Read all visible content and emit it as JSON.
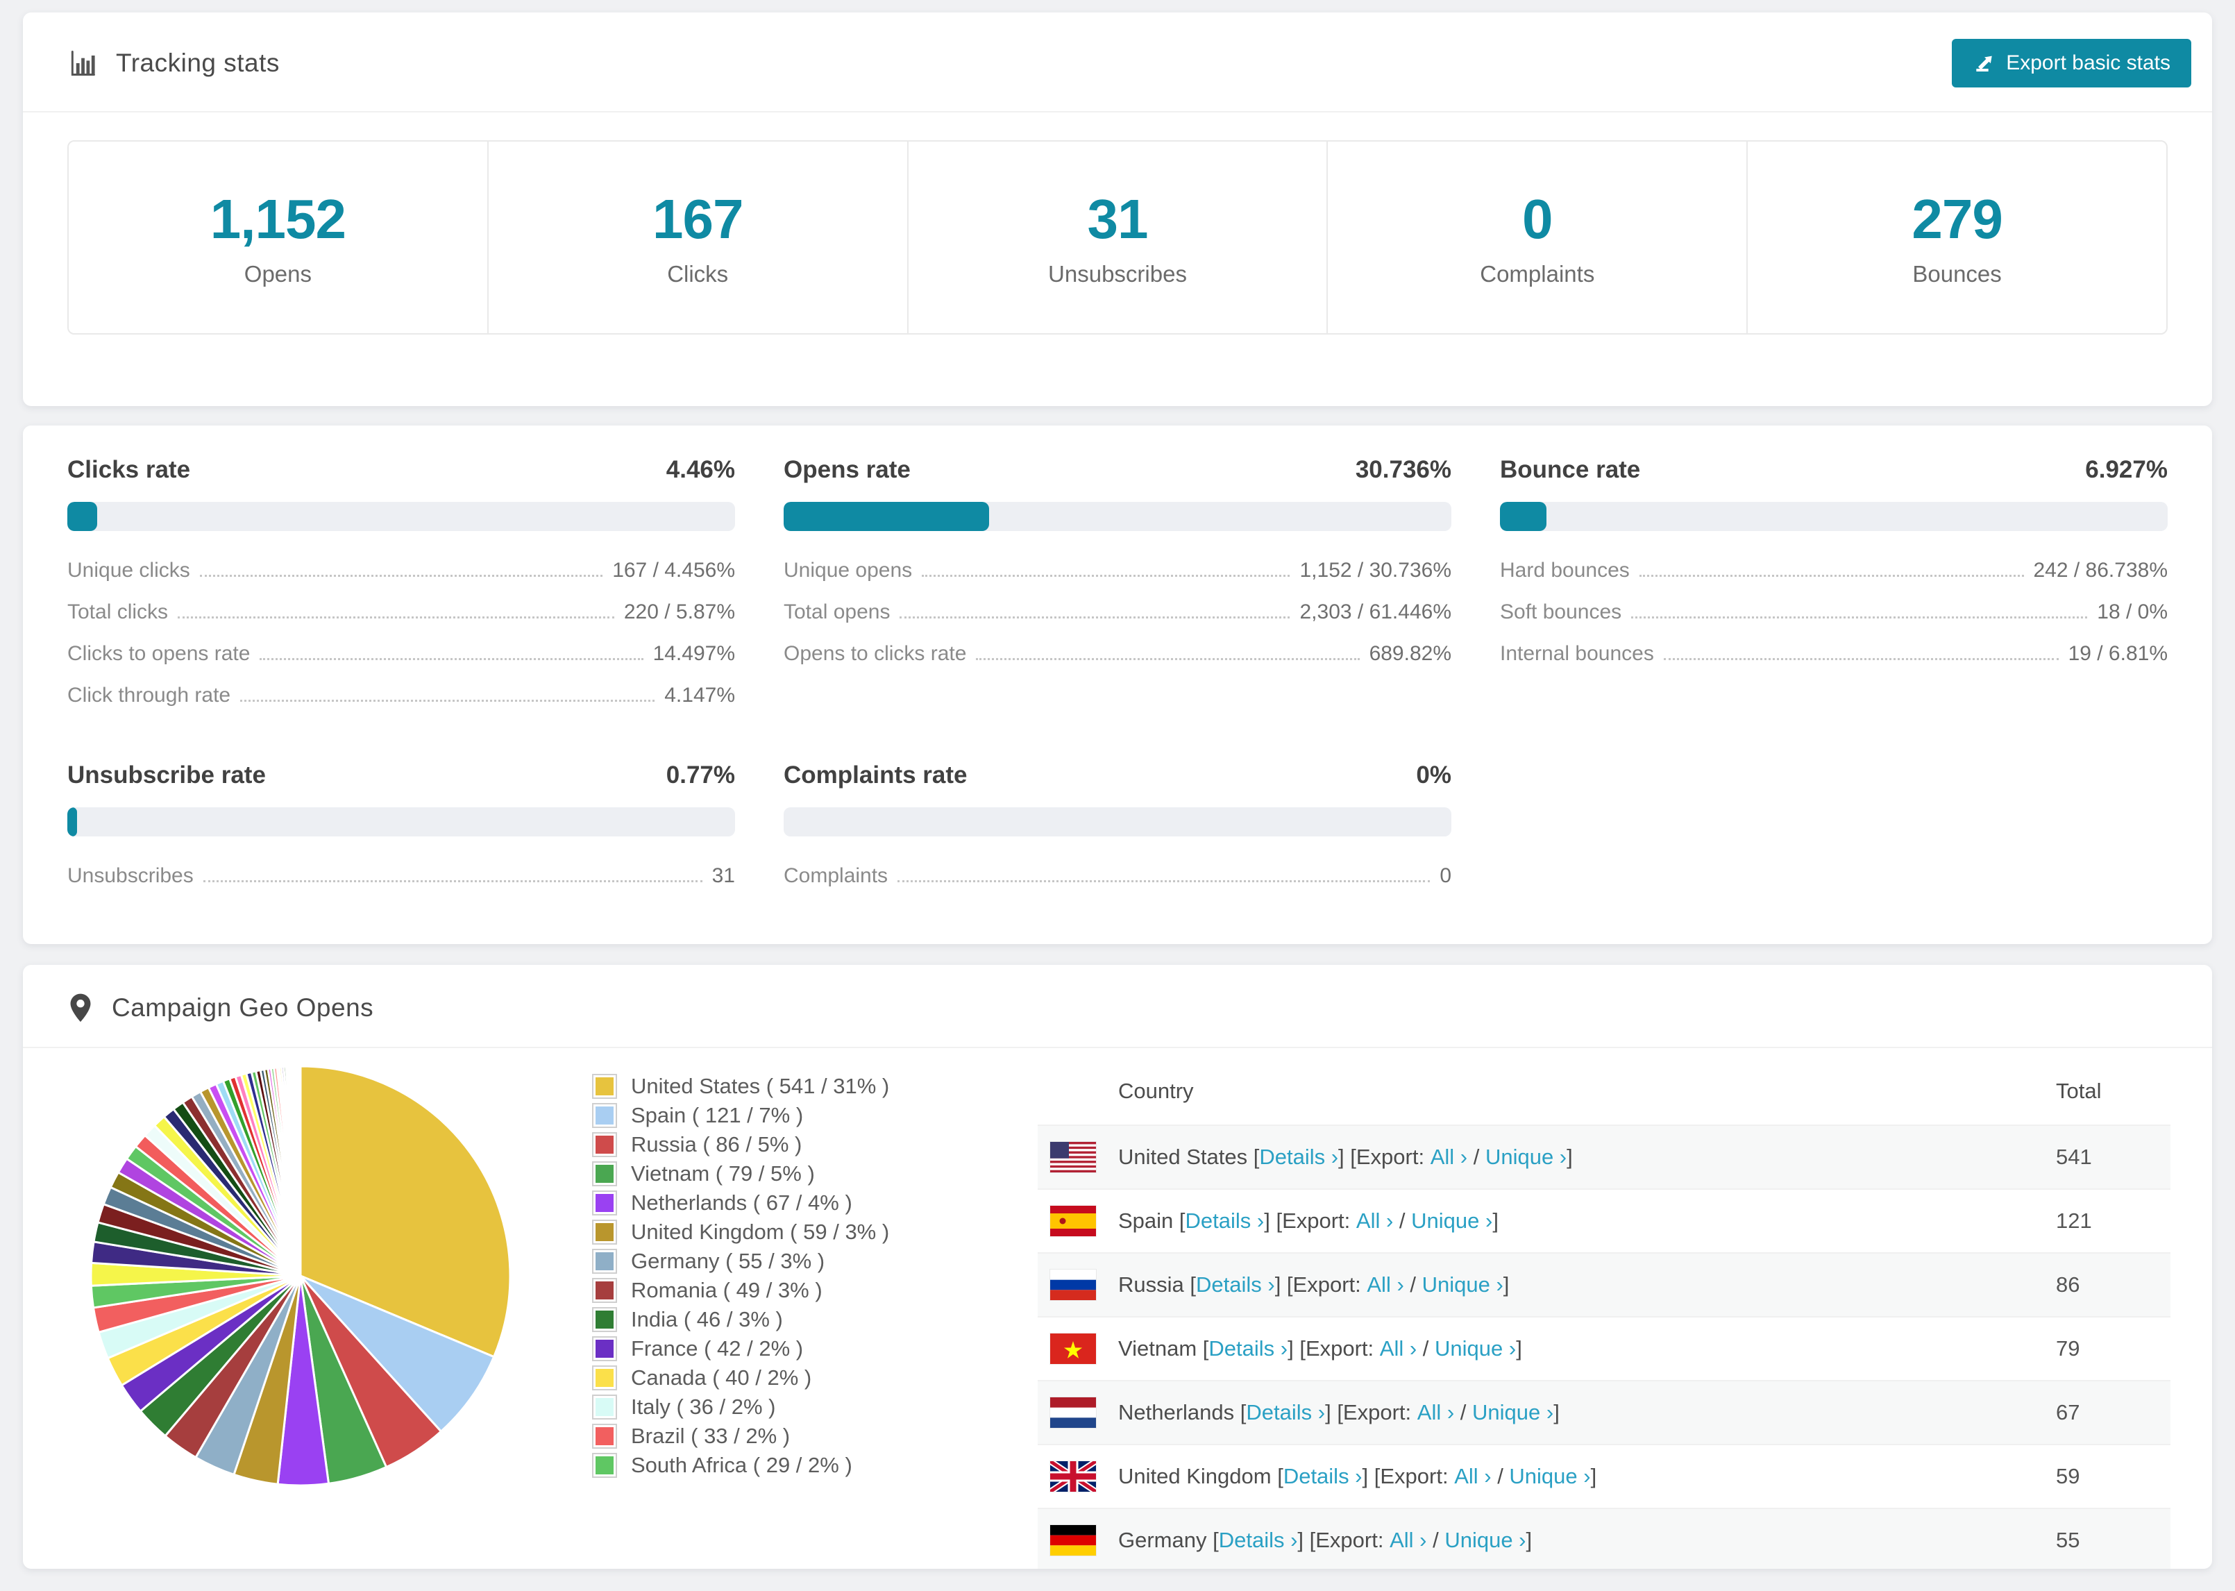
{
  "colors": {
    "accent": "#0f8aa3",
    "link": "#2aa0c4",
    "page_background": "#f0f1f3",
    "bar_track": "#edeff3"
  },
  "header": {
    "title": "Tracking stats",
    "export_label": "Export basic stats",
    "icon": "bar-chart-icon"
  },
  "stats": [
    {
      "value": "1,152",
      "label": "Opens"
    },
    {
      "value": "167",
      "label": "Clicks"
    },
    {
      "value": "31",
      "label": "Unsubscribes"
    },
    {
      "value": "0",
      "label": "Complaints"
    },
    {
      "value": "279",
      "label": "Bounces"
    }
  ],
  "rates": {
    "blocks": [
      {
        "title": "Clicks rate",
        "value": "4.46%",
        "pct": 4.46,
        "rows": [
          {
            "label": "Unique clicks",
            "value": "167 / 4.456%"
          },
          {
            "label": "Total clicks",
            "value": "220 / 5.87%"
          },
          {
            "label": "Clicks to opens rate",
            "value": "14.497%"
          },
          {
            "label": "Click through rate",
            "value": "4.147%"
          }
        ]
      },
      {
        "title": "Opens rate",
        "value": "30.736%",
        "pct": 30.736,
        "rows": [
          {
            "label": "Unique opens",
            "value": "1,152 / 30.736%"
          },
          {
            "label": "Total opens",
            "value": "2,303 / 61.446%"
          },
          {
            "label": "Opens to clicks rate",
            "value": "689.82%"
          }
        ]
      },
      {
        "title": "Bounce rate",
        "value": "6.927%",
        "pct": 6.927,
        "rows": [
          {
            "label": "Hard bounces",
            "value": "242 / 86.738%"
          },
          {
            "label": "Soft bounces",
            "value": "18 / 0%"
          },
          {
            "label": "Internal bounces",
            "value": "19 / 6.81%"
          }
        ]
      },
      {
        "title": "Unsubscribe rate",
        "value": "0.77%",
        "pct": 0.77,
        "rows": [
          {
            "label": "Unsubscribes",
            "value": "31"
          }
        ]
      },
      {
        "title": "Complaints rate",
        "value": "0%",
        "pct": 0,
        "rows": [
          {
            "label": "Complaints",
            "value": "0"
          }
        ]
      }
    ]
  },
  "geo": {
    "title": "Campaign Geo Opens",
    "icon": "map-pin-icon",
    "legend": [
      {
        "label": "United States ( 541 / 31% )",
        "color": "#e7c33e"
      },
      {
        "label": "Spain ( 121 / 7% )",
        "color": "#a9cef2"
      },
      {
        "label": "Russia ( 86 / 5% )",
        "color": "#cf4b4b"
      },
      {
        "label": "Vietnam ( 79 / 5% )",
        "color": "#4aa751"
      },
      {
        "label": "Netherlands ( 67 / 4% )",
        "color": "#9a41f2"
      },
      {
        "label": "United Kingdom ( 59 / 3% )",
        "color": "#b9962d"
      },
      {
        "label": "Germany ( 55 / 3% )",
        "color": "#8fafc7"
      },
      {
        "label": "Romania ( 49 / 3% )",
        "color": "#a63e3e"
      },
      {
        "label": "India ( 46 / 3% )",
        "color": "#2f7d33"
      },
      {
        "label": "France ( 42 / 2% )",
        "color": "#6b2fc4"
      },
      {
        "label": "Canada ( 40 / 2% )",
        "color": "#fbe04a"
      },
      {
        "label": "Italy ( 36 / 2% )",
        "color": "#d8fbf6"
      },
      {
        "label": "Brazil ( 33 / 2% )",
        "color": "#f25f5f"
      },
      {
        "label": "South Africa ( 29 / 2% )",
        "color": "#5fc763"
      }
    ],
    "table": {
      "headers": [
        "Country",
        "Total"
      ],
      "link_labels": {
        "details": "Details ›",
        "all": "All ›",
        "unique": "Unique ›"
      },
      "punct": {
        "p1": " [",
        "p2": "] [Export: ",
        "p3": " / ",
        "p4": "]"
      },
      "rows": [
        {
          "country": "United States",
          "flag": "us",
          "total": "541"
        },
        {
          "country": "Spain",
          "flag": "es",
          "total": "121"
        },
        {
          "country": "Russia",
          "flag": "ru",
          "total": "86"
        },
        {
          "country": "Vietnam",
          "flag": "vn",
          "total": "79"
        },
        {
          "country": "Netherlands",
          "flag": "nl",
          "total": "67"
        },
        {
          "country": "United Kingdom",
          "flag": "gb",
          "total": "59"
        },
        {
          "country": "Germany",
          "flag": "de",
          "total": "55"
        }
      ]
    }
  },
  "chart_data": {
    "type": "pie",
    "title": "Campaign Geo Opens",
    "legend_position": "right",
    "slices": [
      {
        "label": "United States",
        "value": 541,
        "pct": 31,
        "color": "#e7c33e"
      },
      {
        "label": "Spain",
        "value": 121,
        "pct": 7,
        "color": "#a9cef2"
      },
      {
        "label": "Russia",
        "value": 86,
        "pct": 5,
        "color": "#cf4b4b"
      },
      {
        "label": "Vietnam",
        "value": 79,
        "pct": 5,
        "color": "#4aa751"
      },
      {
        "label": "Netherlands",
        "value": 67,
        "pct": 4,
        "color": "#9a41f2"
      },
      {
        "label": "United Kingdom",
        "value": 59,
        "pct": 3,
        "color": "#b9962d"
      },
      {
        "label": "Germany",
        "value": 55,
        "pct": 3,
        "color": "#8fafc7"
      },
      {
        "label": "Romania",
        "value": 49,
        "pct": 3,
        "color": "#a63e3e"
      },
      {
        "label": "India",
        "value": 46,
        "pct": 3,
        "color": "#2f7d33"
      },
      {
        "label": "France",
        "value": 42,
        "pct": 2,
        "color": "#6b2fc4"
      },
      {
        "label": "Canada",
        "value": 40,
        "pct": 2,
        "color": "#fbe04a"
      },
      {
        "label": "Italy",
        "value": 36,
        "pct": 2,
        "color": "#d8fbf6"
      },
      {
        "label": "Brazil",
        "value": 33,
        "pct": 2,
        "color": "#f25f5f"
      },
      {
        "label": "South Africa",
        "value": 29,
        "pct": 2,
        "color": "#5fc763"
      }
    ],
    "others": [
      {
        "value": 30,
        "color": "#f5f54a"
      },
      {
        "value": 28,
        "color": "#3f2a84"
      },
      {
        "value": 26,
        "color": "#1d5e2c"
      },
      {
        "value": 25,
        "color": "#7b1f1f"
      },
      {
        "value": 24,
        "color": "#5b7d95"
      },
      {
        "value": 22,
        "color": "#857616"
      },
      {
        "value": 21,
        "color": "#b044e0"
      },
      {
        "value": 20,
        "color": "#5fc763"
      },
      {
        "value": 19,
        "color": "#f25c5c"
      },
      {
        "value": 18,
        "color": "#eefcfa"
      },
      {
        "value": 17,
        "color": "#f5f54a"
      },
      {
        "value": 16,
        "color": "#2a2a72"
      },
      {
        "value": 15,
        "color": "#144d14"
      },
      {
        "value": 14,
        "color": "#8c2f2f"
      },
      {
        "value": 13,
        "color": "#94aec2"
      },
      {
        "value": 12,
        "color": "#b8962e"
      },
      {
        "value": 11,
        "color": "#c94ef2"
      },
      {
        "value": 10,
        "color": "#9fdbf5"
      },
      {
        "value": 9,
        "color": "#33a02c"
      },
      {
        "value": 8,
        "color": "#e03131"
      },
      {
        "value": 8,
        "color": "#ff80c0"
      },
      {
        "value": 7,
        "color": "#ffff66"
      },
      {
        "value": 7,
        "color": "#2f2f8f"
      },
      {
        "value": 6,
        "color": "#62c462"
      },
      {
        "value": 6,
        "color": "#5c1010"
      },
      {
        "value": 5,
        "color": "#3c5a70"
      },
      {
        "value": 5,
        "color": "#6b6114"
      },
      {
        "value": 4,
        "color": "#e060e0"
      },
      {
        "value": 4,
        "color": "#80d080"
      },
      {
        "value": 4,
        "color": "#ff9090"
      },
      {
        "value": 3,
        "color": "#d0f0ff"
      },
      {
        "value": 3,
        "color": "#ffe030"
      },
      {
        "value": 3,
        "color": "#503090"
      },
      {
        "value": 3,
        "color": "#206020"
      },
      {
        "value": 2,
        "color": "#802020"
      },
      {
        "value": 2,
        "color": "#7090a8"
      },
      {
        "value": 2,
        "color": "#a08020"
      },
      {
        "value": 2,
        "color": "#f0a0f0"
      },
      {
        "value": 2,
        "color": "#c0ffc0"
      },
      {
        "value": 1,
        "color": "#ffc0c0"
      },
      {
        "value": 1,
        "color": "#e8ffff"
      },
      {
        "value": 1,
        "color": "#fff890"
      },
      {
        "value": 1,
        "color": "#d8c0f8"
      },
      {
        "value": 1,
        "color": "#b8e8b8"
      },
      {
        "value": 1,
        "color": "#f8d8d8"
      },
      {
        "value": 1,
        "color": "#e0e8f0"
      },
      {
        "value": 1,
        "color": "#f0f0f8"
      },
      {
        "value": 1,
        "color": "#fafafa"
      }
    ]
  }
}
